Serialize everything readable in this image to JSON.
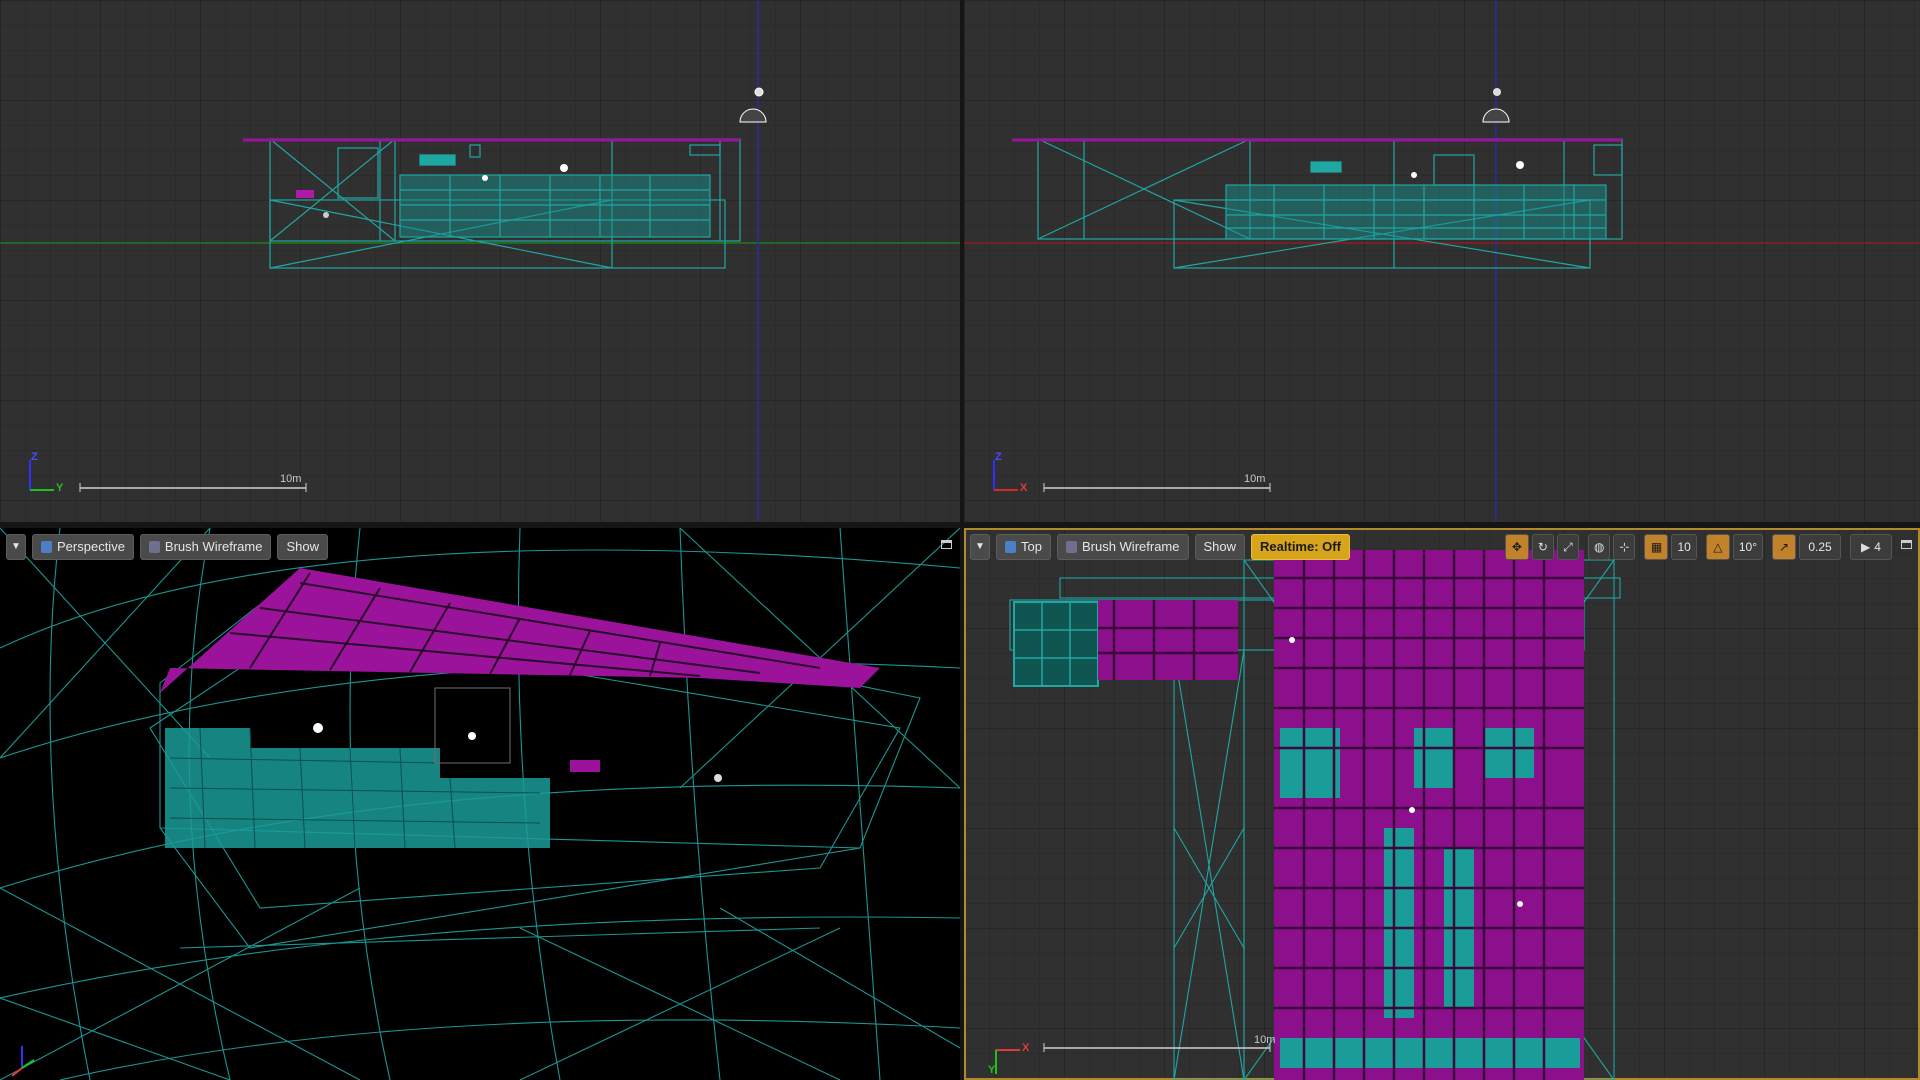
{
  "viewports": {
    "side": {
      "scale_label": "10m",
      "axis_h": "Y",
      "axis_v": "Z"
    },
    "front": {
      "scale_label": "10m",
      "axis_h": "X",
      "axis_v": "Z"
    },
    "perspective": {
      "view_mode": "Perspective",
      "view_type": "Brush Wireframe",
      "show": "Show"
    },
    "top": {
      "view_mode": "Top",
      "view_type": "Brush Wireframe",
      "show": "Show",
      "realtime": "Realtime: Off",
      "grid_snap": "10",
      "rotation_snap": "10°",
      "scale_snap": "0.25",
      "camera_speed": "4",
      "scale_label": "10m",
      "axis_h": "X",
      "axis_v": "Y"
    }
  },
  "colors": {
    "wire_cyan": "#1fa7a3",
    "wire_magenta": "#9b139b",
    "viewport_bg": "#303030",
    "active_border": "#b28a2a",
    "realtime_off": "#d6a51c"
  }
}
